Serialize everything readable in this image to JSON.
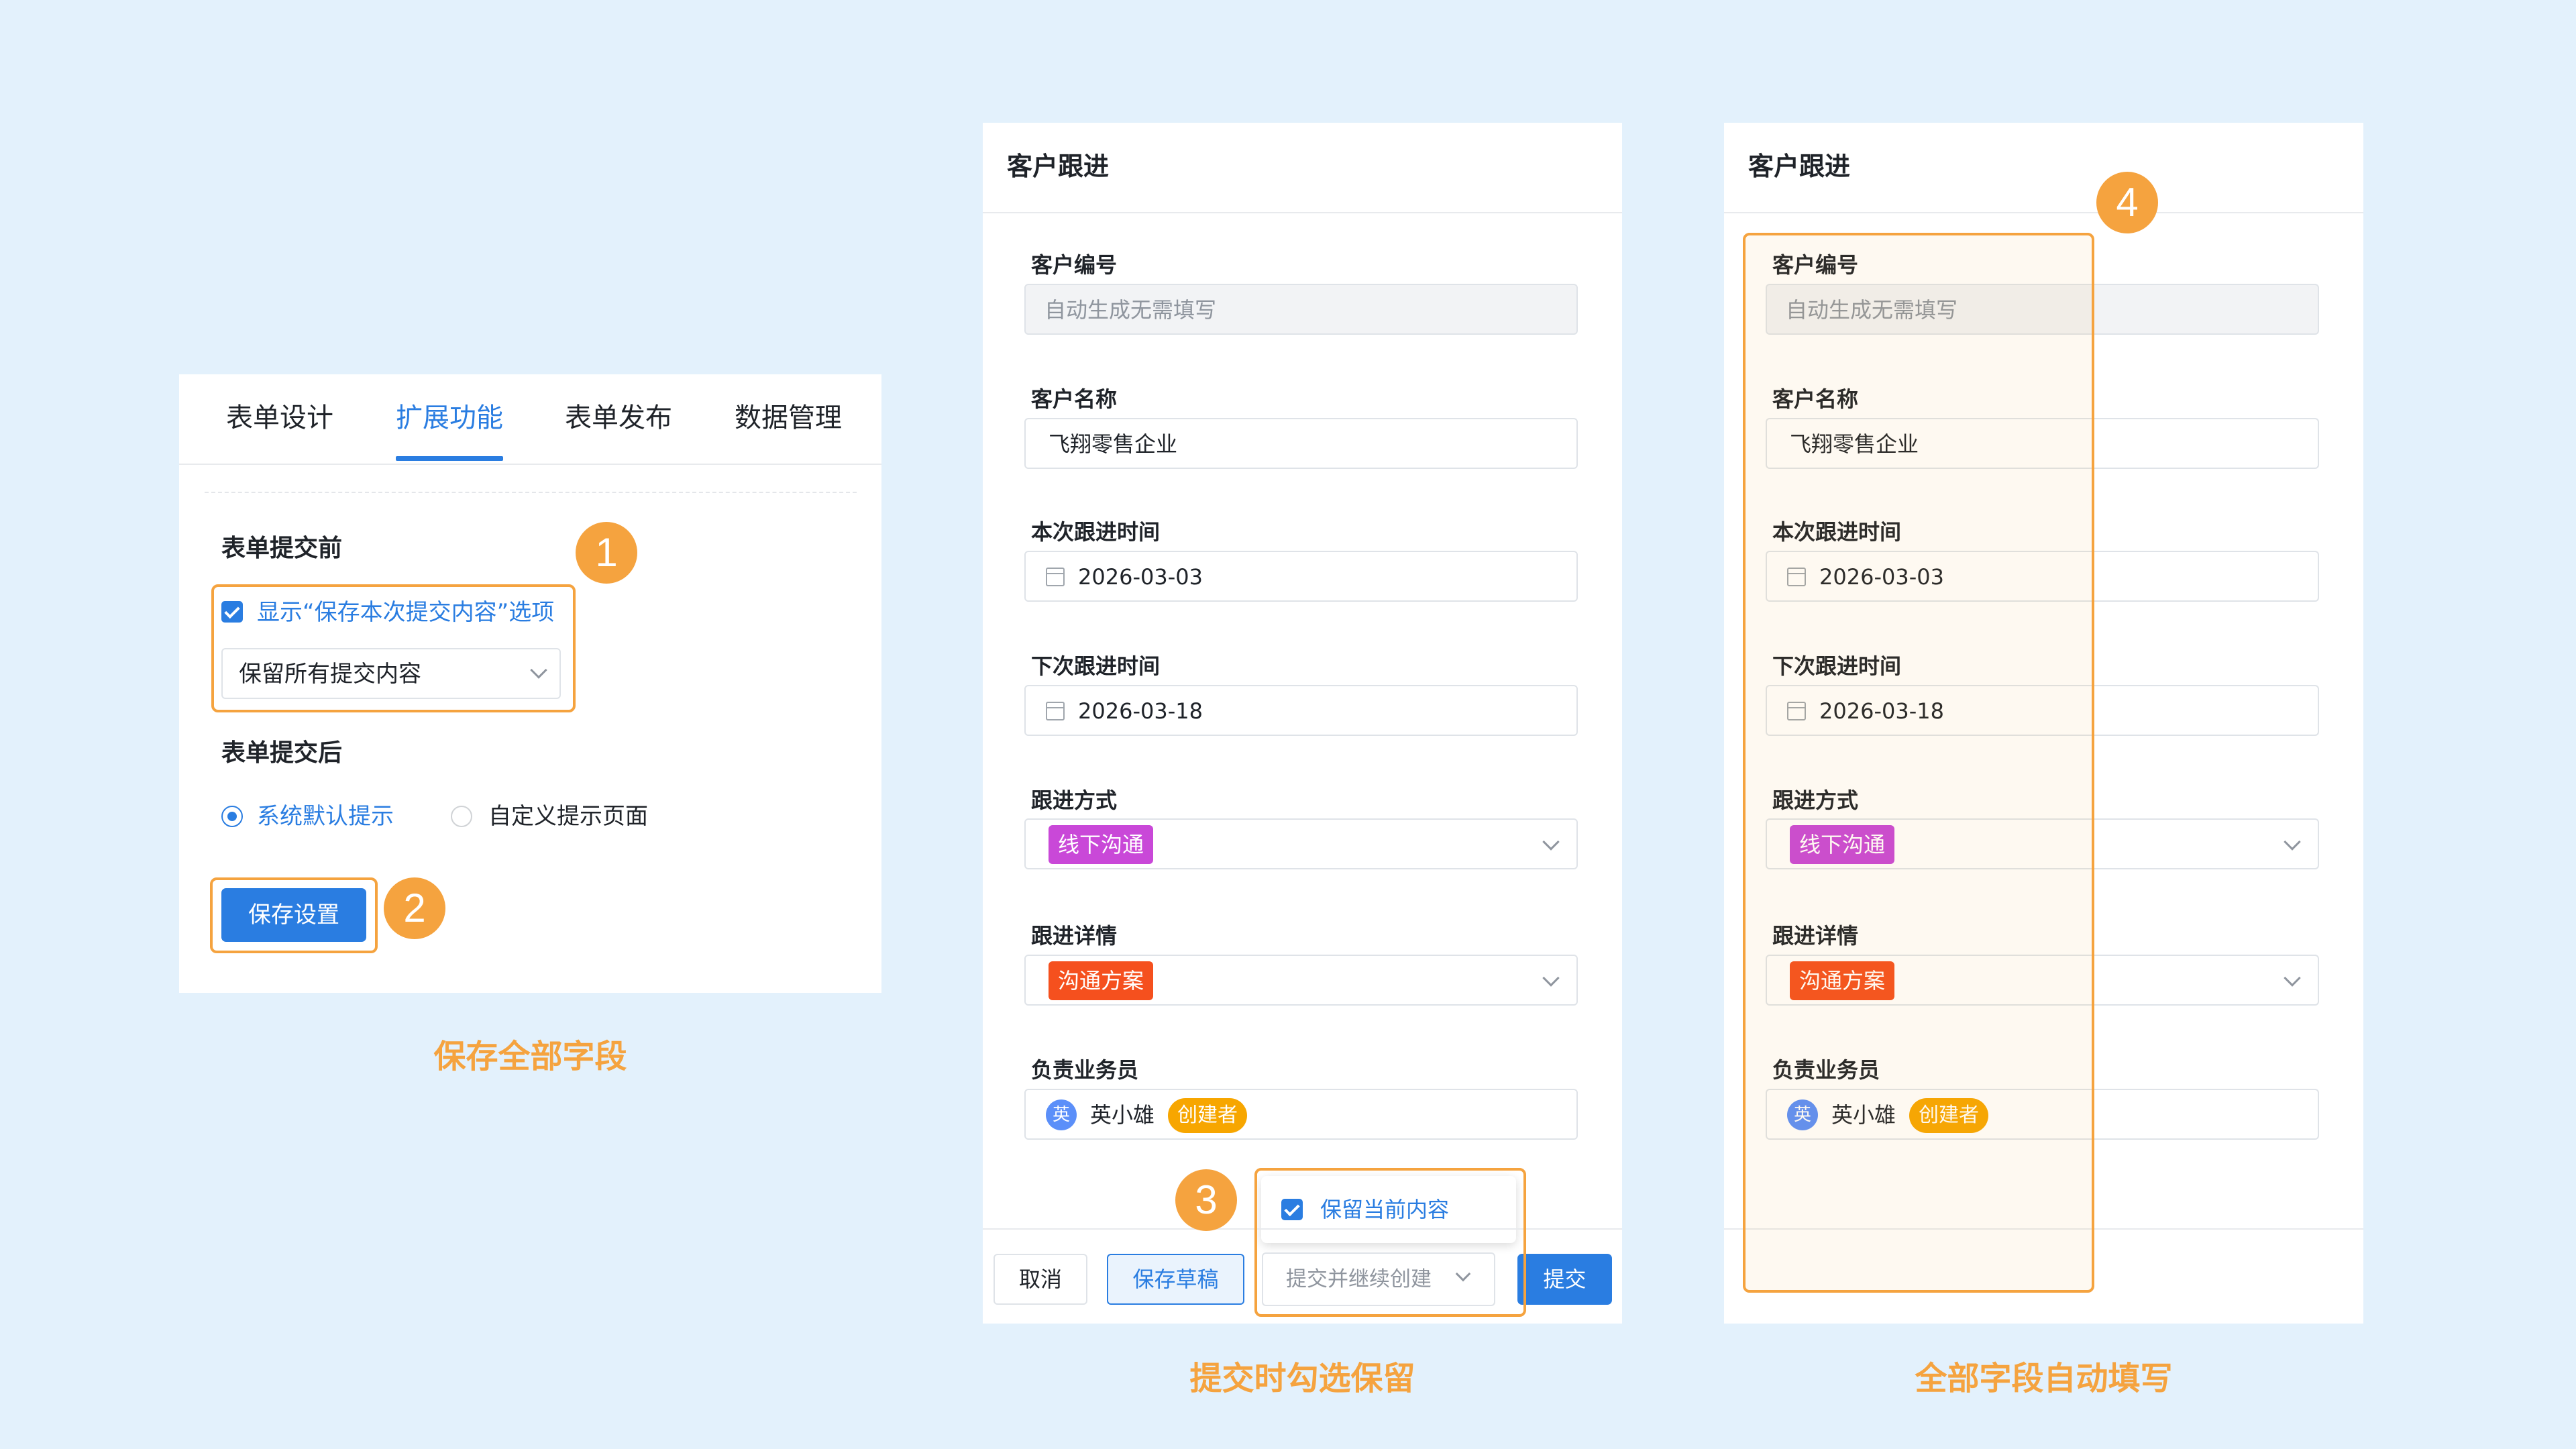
{
  "colors": {
    "background": "#e3f1fc",
    "accent": "#2a7de1",
    "highlight": "#f5a33f",
    "tag_purple": "#c948d8",
    "tag_red": "#f5501e",
    "creator_badge": "#f7a600"
  },
  "settings_panel": {
    "tabs": [
      "表单设计",
      "扩展功能",
      "表单发布",
      "数据管理"
    ],
    "active_tab": "扩展功能",
    "before_submit": {
      "title": "表单提交前",
      "checkbox_label": "显示“保存本次提交内容”选项",
      "checkbox_checked": true,
      "select_value": "保留所有提交内容"
    },
    "after_submit": {
      "title": "表单提交后",
      "options": [
        "系统默认提示",
        "自定义提示页面"
      ],
      "selected": "系统默认提示"
    },
    "save_button": "保存设置",
    "caption": "保存全部字段"
  },
  "badges": [
    "1",
    "2",
    "3",
    "4"
  ],
  "form_panel": {
    "title": "客户跟进",
    "fields": {
      "customer_no": {
        "label": "客户编号",
        "placeholder": "自动生成无需填写"
      },
      "customer_name": {
        "label": "客户名称",
        "value": "飞翔零售企业"
      },
      "follow_time": {
        "label": "本次跟进时间",
        "value": "2026-03-03"
      },
      "next_time": {
        "label": "下次跟进时间",
        "value": "2026-03-18"
      },
      "method": {
        "label": "跟进方式",
        "value": "线下沟通"
      },
      "detail": {
        "label": "跟进详情",
        "value": "沟通方案"
      },
      "owner": {
        "label": "负责业务员",
        "avatar": "英",
        "name": "英小雄",
        "role": "创建者"
      }
    },
    "keep_option": {
      "label": "保留当前内容",
      "checked": true
    },
    "footer": {
      "cancel": "取消",
      "draft": "保存草稿",
      "continue": "提交并继续创建",
      "submit": "提交"
    },
    "caption": "提交时勾选保留"
  },
  "autofill_caption": "全部字段自动填写"
}
